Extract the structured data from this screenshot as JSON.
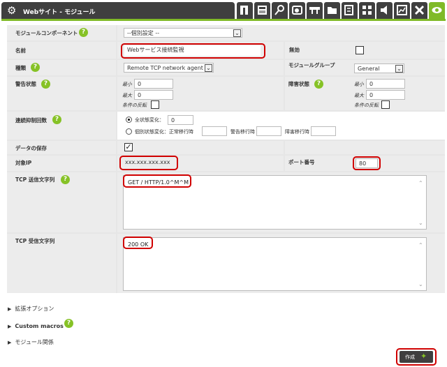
{
  "header": {
    "title": "Webサイト - モジュール",
    "icons": [
      "view-icon",
      "snmp-icon",
      "wizard-icon",
      "agent-config-icon",
      "network-icon",
      "folder-icon",
      "template-icon",
      "inventory-icon",
      "alerts-icon",
      "statistics-icon",
      "tools-icon",
      "eye-icon"
    ]
  },
  "form": {
    "component": {
      "label": "モジュールコンポーネント",
      "value": "--個別設定 --"
    },
    "name": {
      "label": "名前",
      "value": "Webサービス接続監視"
    },
    "disabled": {
      "label": "無効"
    },
    "type": {
      "label": "種類",
      "value": "Remote TCP network agent"
    },
    "module_group": {
      "label": "モジュールグループ",
      "value": "General"
    },
    "warning": {
      "label": "警告状態",
      "min_label": "最小",
      "min": "0",
      "max_label": "最大",
      "max": "0",
      "inverse_label": "条件の反転"
    },
    "critical": {
      "label": "障害状態",
      "min_label": "最小",
      "min": "0",
      "max_label": "最大",
      "max": "0",
      "inverse_label": "条件の反転"
    },
    "ff": {
      "label": "連続抑制回数",
      "all_label": "全状態変化：",
      "all_value": "0",
      "each_label": "個別状態変化：正常移行時",
      "warn_label": "警告移行時",
      "crit_label": "障害移行時"
    },
    "history": {
      "label": "データの保存"
    },
    "target_ip": {
      "label": "対象IP",
      "value": "xxx.xxx.xxx.xxx"
    },
    "port": {
      "label": "ポート番号",
      "value": "80"
    },
    "tcp_send": {
      "label": "TCP 送信文字列",
      "value": "GET / HTTP/1.0^M^M"
    },
    "tcp_recv": {
      "label": "TCP 受信文字列",
      "value": "200 OK"
    }
  },
  "sections": {
    "advanced": "拡張オプション",
    "macros": "Custom macros",
    "relations": "モジュール関係"
  },
  "buttons": {
    "create": "作成"
  },
  "colors": {
    "accent": "#80ba27",
    "dark": "#3f3f3f",
    "highlight": "#d00000"
  }
}
